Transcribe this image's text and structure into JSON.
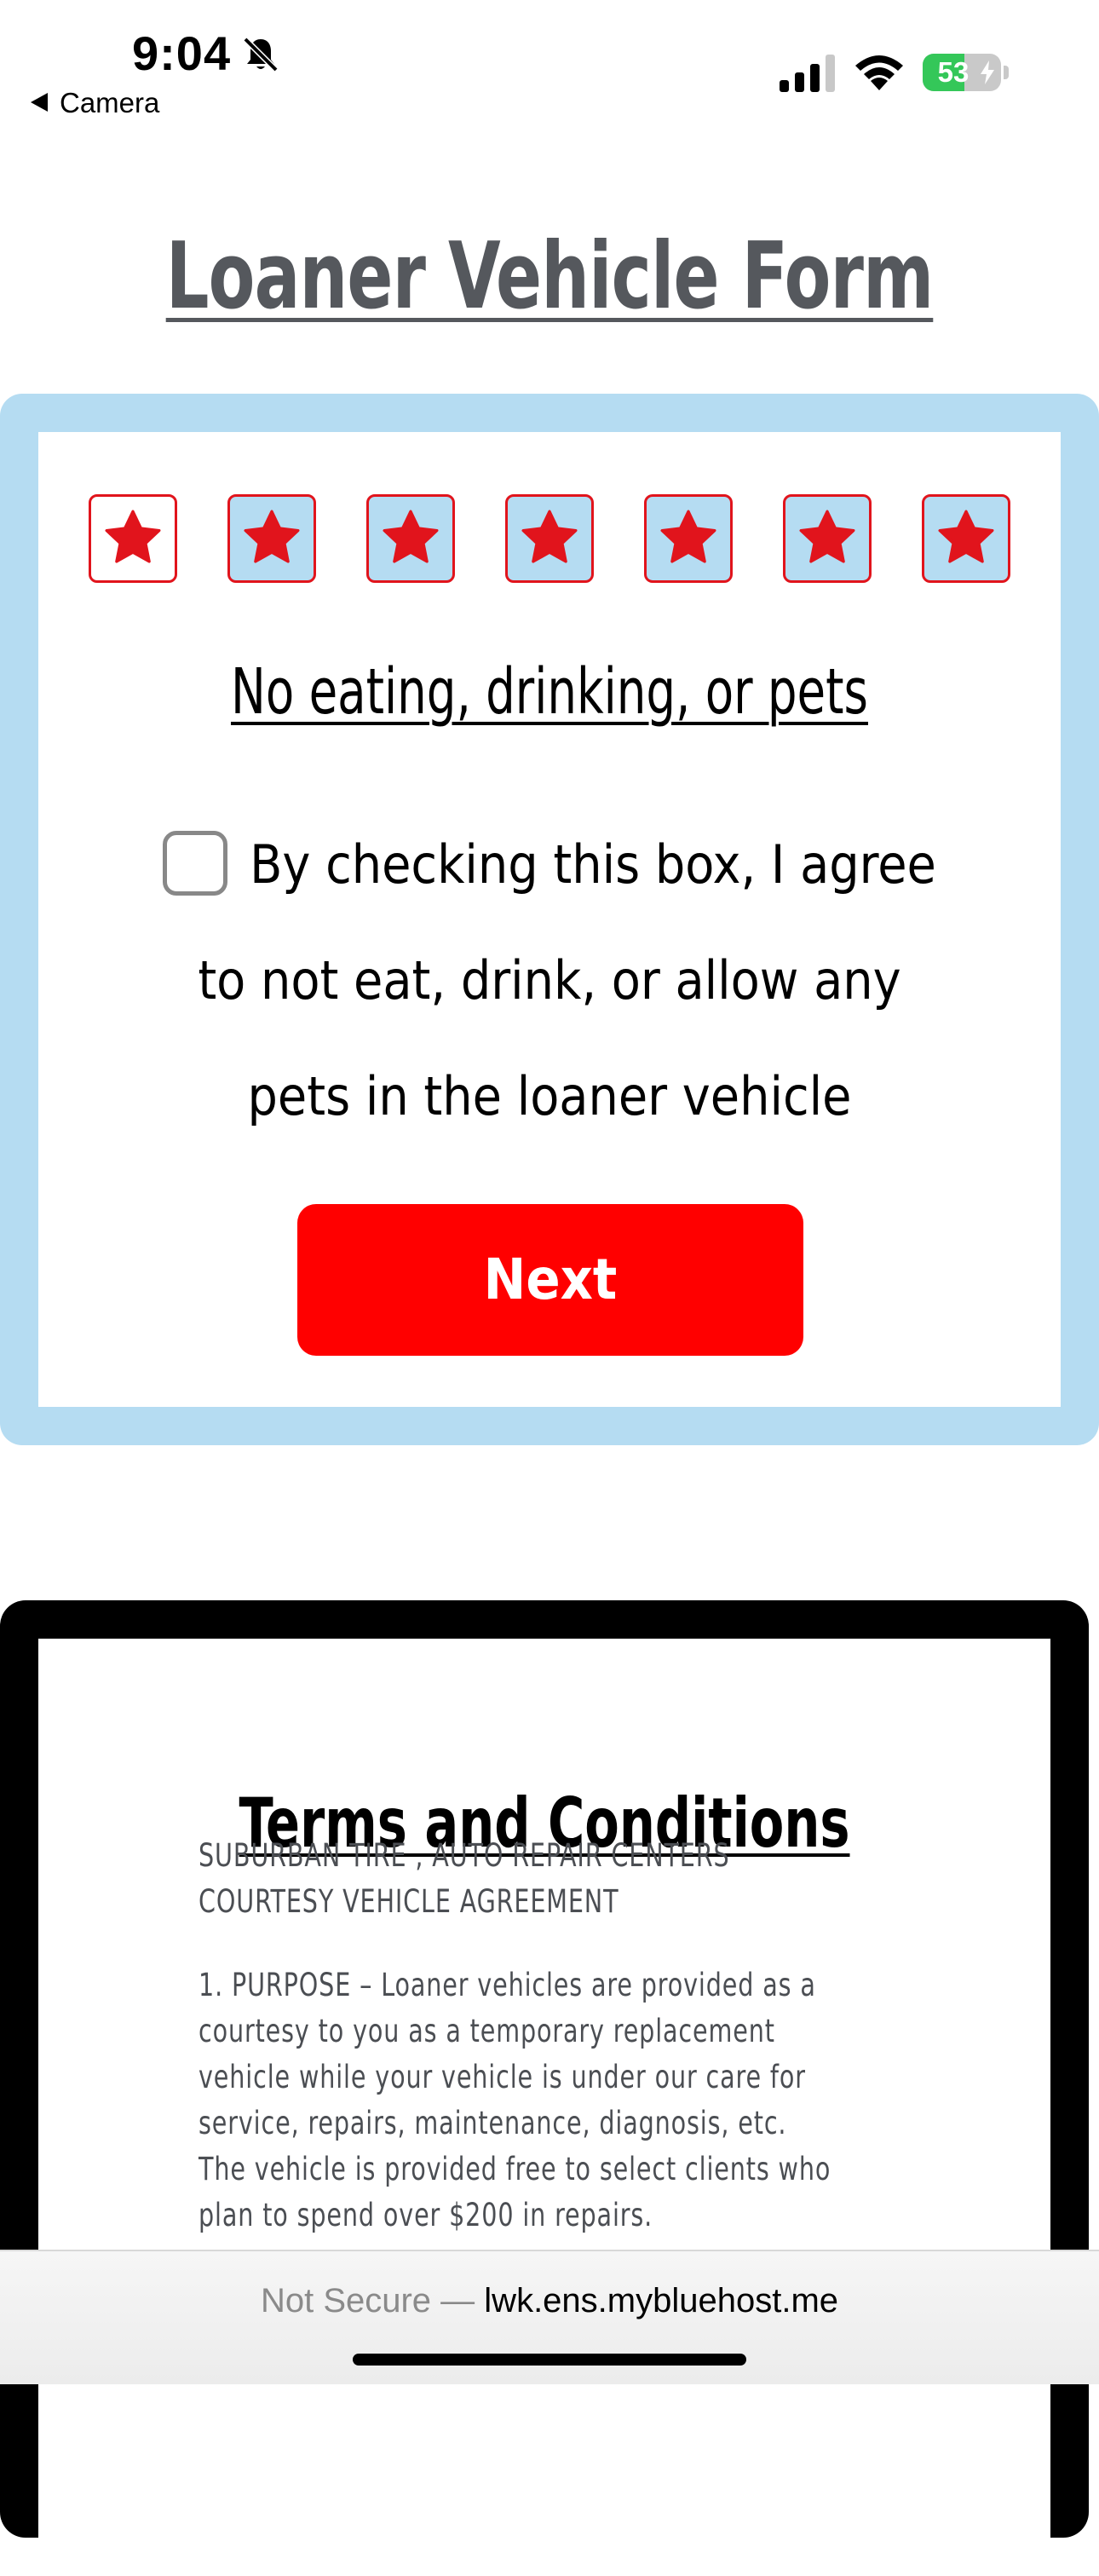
{
  "status": {
    "time": "9:04",
    "back_app": "Camera",
    "battery": "53",
    "battery_level": 0.53,
    "battery_color": "#34c759"
  },
  "page": {
    "title": "Loaner Vehicle Form"
  },
  "progress": {
    "total_steps": 7,
    "current_step": 1,
    "icon": "star-icon",
    "star_color": "#e1141c"
  },
  "rule": {
    "heading": "No eating, drinking, or pets",
    "agreement_text": "By checking this box, I agree to not eat, drink, or allow any pets in the loaner vehicle",
    "checked": false,
    "next_label": "Next",
    "next_color": "#ff0000"
  },
  "terms": {
    "title": "Terms and Conditions",
    "lines": [
      "SUBURBAN TIRE , AUTO REPAIR CENTERS",
      "COURTESY VEHICLE AGREEMENT",
      "",
      "1. PURPOSE – Loaner vehicles are provided as a",
      "courtesy to you as a temporary replacement",
      "vehicle while your vehicle is under our care for",
      "service, repairs, maintenance, diagnosis, etc.",
      "The vehicle is provided free to select clients who",
      "plan to spend over $200 in repairs."
    ]
  },
  "browser": {
    "security": "Not Secure —",
    "url": "lwk.ens.mybluehost.me"
  }
}
